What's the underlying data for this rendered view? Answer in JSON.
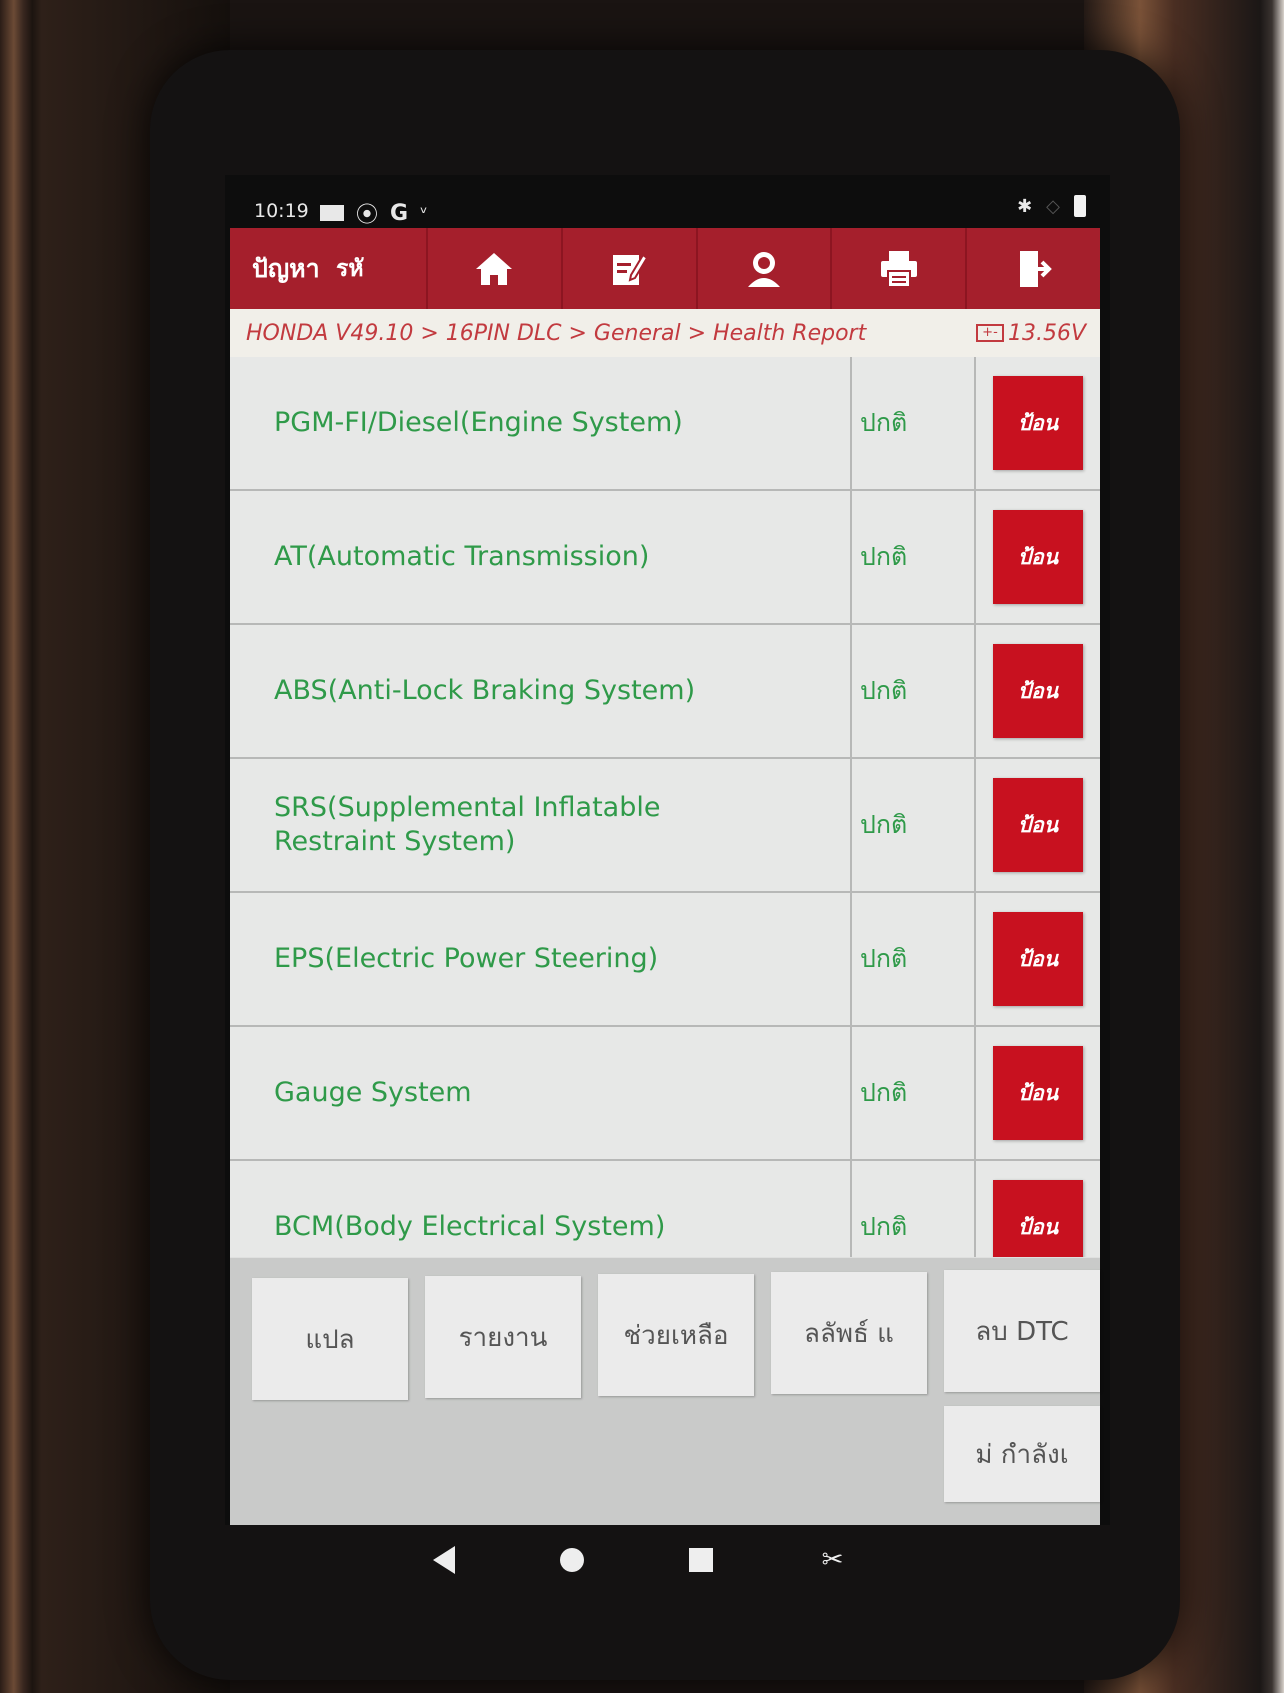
{
  "status_bar": {
    "time": "10:19",
    "icons": [
      "mail-icon",
      "signal-icon",
      "google-icon",
      "stethoscope-icon"
    ],
    "right_icons": [
      "bluetooth-icon",
      "wifi-icon",
      "battery-icon"
    ]
  },
  "toolbar": {
    "label1": "ปัญหา",
    "label2": "รหั",
    "buttons": [
      "home-icon",
      "edit-icon",
      "profile-icon",
      "print-icon",
      "exit-icon"
    ]
  },
  "breadcrumb": {
    "path": "HONDA V49.10 > 16PIN DLC > General > Health Report",
    "voltage": "13.56V",
    "battery_glyph": "+-"
  },
  "systems": [
    {
      "name": "PGM-FI/Diesel(Engine System)",
      "status": "ปกติ",
      "button": "ป้อน"
    },
    {
      "name": "AT(Automatic Transmission)",
      "status": "ปกติ",
      "button": "ป้อน"
    },
    {
      "name": "ABS(Anti-Lock Braking System)",
      "status": "ปกติ",
      "button": "ป้อน"
    },
    {
      "name": "SRS(Supplemental Inflatable Restraint System)",
      "status": "ปกติ",
      "button": "ป้อน"
    },
    {
      "name": "EPS(Electric Power Steering)",
      "status": "ปกติ",
      "button": "ป้อน"
    },
    {
      "name": "Gauge System",
      "status": "ปกติ",
      "button": "ป้อน"
    },
    {
      "name": "BCM(Body Electrical System)",
      "status": "ปกติ",
      "button": "ป้อน"
    }
  ],
  "bottom_buttons": {
    "translate": "แปล",
    "report": "รายงาน",
    "help": "ช่วยเหลือ",
    "shortcut": "ลลัพธ์ แ",
    "clear_dtc": "ลบ DTC",
    "processing": "ม่ กำลังเ"
  },
  "colors": {
    "toolbar": "#a51f2c",
    "button_red": "#c8111f",
    "system_text": "#2f9a49",
    "breadcrumb_text": "#c23a3f"
  }
}
